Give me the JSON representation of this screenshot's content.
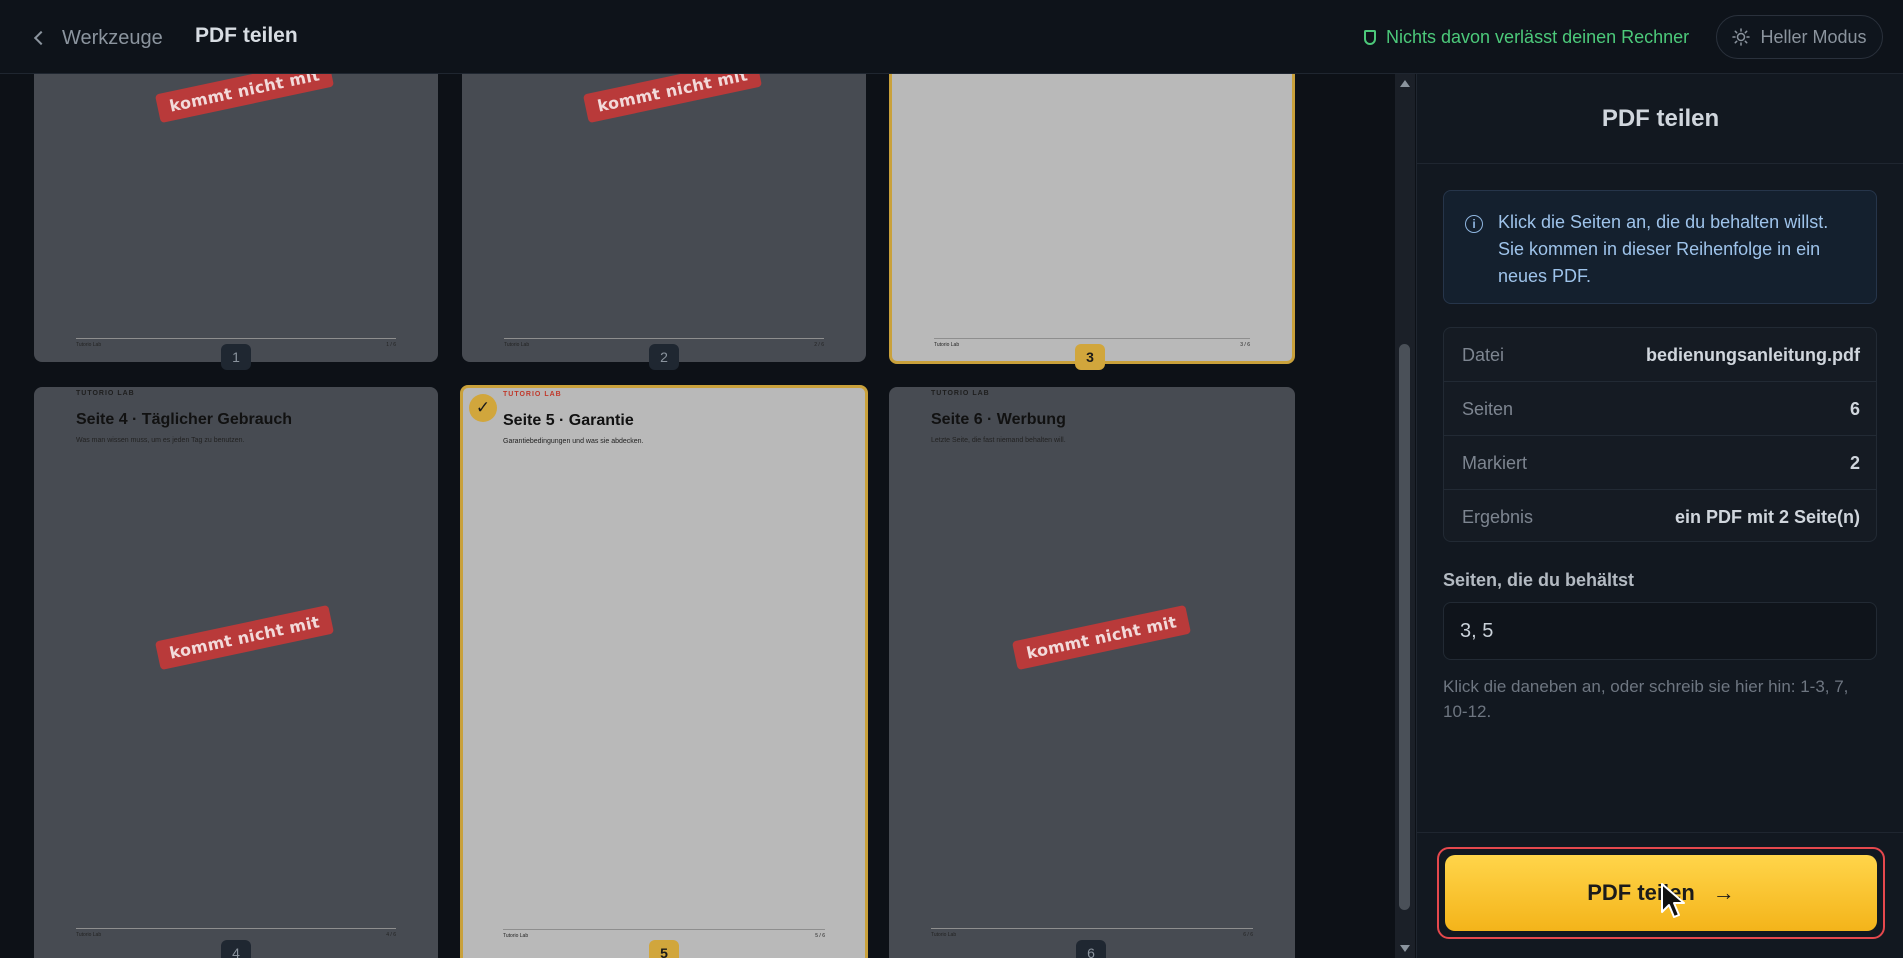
{
  "header": {
    "back_label": "Werkzeuge",
    "title": "PDF teilen",
    "privacy_text": "Nichts davon verlässt deinen Rechner",
    "theme_label": "Heller Modus"
  },
  "pages": [
    {
      "number": "1",
      "selected": false,
      "brand": "",
      "title": "",
      "subtitle": "",
      "stamp": "kommt nicht mit",
      "footer_left": "Tutorio Lab",
      "footer_right": "1 / 6"
    },
    {
      "number": "2",
      "selected": false,
      "brand": "",
      "title": "",
      "subtitle": "",
      "stamp": "kommt nicht mit",
      "footer_left": "Tutorio Lab",
      "footer_right": "2 / 6"
    },
    {
      "number": "3",
      "selected": true,
      "brand": "",
      "title": "",
      "subtitle": "",
      "stamp": "",
      "footer_left": "Tutorio Lab",
      "footer_right": "3 / 6"
    },
    {
      "number": "4",
      "selected": false,
      "brand": "TUTORIO LAB",
      "title": "Seite 4 · Täglicher Gebrauch",
      "subtitle": "Was man wissen muss, um es jeden Tag zu benutzen.",
      "stamp": "kommt nicht mit",
      "footer_left": "Tutorio Lab",
      "footer_right": "4 / 6"
    },
    {
      "number": "5",
      "selected": true,
      "brand": "TUTORIO LAB",
      "title": "Seite 5 · Garantie",
      "subtitle": "Garantiebedingungen und was sie abdecken.",
      "stamp": "",
      "footer_left": "Tutorio Lab",
      "footer_right": "5 / 6"
    },
    {
      "number": "6",
      "selected": false,
      "brand": "TUTORIO LAB",
      "title": "Seite 6 · Werbung",
      "subtitle": "Letzte Seite, die fast niemand behalten will.",
      "stamp": "kommt nicht mit",
      "footer_left": "Tutorio Lab",
      "footer_right": "6 / 6"
    }
  ],
  "panel": {
    "title": "PDF teilen",
    "info_text": "Klick die Seiten an, die du behalten willst. Sie kommen in dieser Reihenfolge in ein neues PDF.",
    "meta": [
      {
        "key": "Datei",
        "value": "bedienungsanleitung.pdf"
      },
      {
        "key": "Seiten",
        "value": "6"
      },
      {
        "key": "Markiert",
        "value": "2"
      },
      {
        "key": "Ergebnis",
        "value": "ein PDF mit 2 Seite(n)"
      }
    ],
    "field_label": "Seiten, die du behältst",
    "field_value": "3, 5",
    "hint": "Klick die daneben an, oder schreib sie hier hin: 1-3, 7, 10-12.",
    "cta_label": "PDF teilen",
    "cta_arrow": "→"
  },
  "colors": {
    "accent": "#f4b41a",
    "privacy_green": "#4cc97a",
    "selected_border": "#c9a13b",
    "stamp_red": "#b93a3a"
  }
}
